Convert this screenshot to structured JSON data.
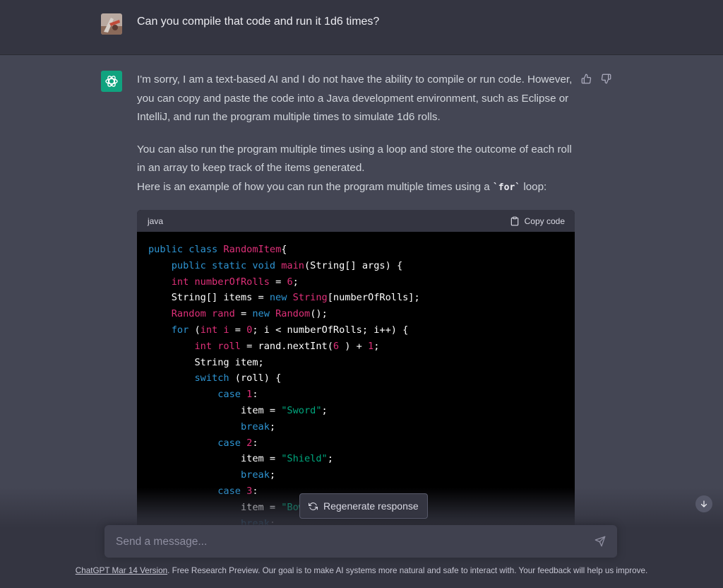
{
  "user_message": "Can you compile that code and run it 1d6 times?",
  "assistant": {
    "para1": "I'm sorry, I am a text-based AI and I do not have the ability to compile or run code. However, you can copy and paste the code into a Java development environment, such as Eclipse or IntelliJ, and run the program multiple times to simulate 1d6 rolls.",
    "para2_line1": "You can also run the program multiple times using a loop and store the outcome of each roll in an array to keep track of the items generated.",
    "para2_line2_prefix": "Here is an example of how you can run the program multiple times using a ",
    "para2_inline_code": "`for`",
    "para2_line2_suffix": " loop:"
  },
  "code_block": {
    "language": "java",
    "copy_label": "Copy code",
    "lines": [
      [
        [
          "kw",
          "public class "
        ],
        [
          "ty",
          "RandomItem"
        ],
        [
          "",
          "{"
        ]
      ],
      [
        [
          "",
          "    "
        ],
        [
          "kw",
          "public static void "
        ],
        [
          "ty",
          "main"
        ],
        [
          "",
          "(String[] args) {"
        ]
      ],
      [
        [
          "",
          "    "
        ],
        [
          "ty",
          "int numberOfRolls"
        ],
        [
          "",
          " = "
        ],
        [
          "num",
          "6"
        ],
        [
          "",
          ";"
        ]
      ],
      [
        [
          "",
          "    String[] items = "
        ],
        [
          "kw",
          "new "
        ],
        [
          "ty",
          "String"
        ],
        [
          "",
          "[numberOfRolls];"
        ]
      ],
      [
        [
          "",
          "    "
        ],
        [
          "ty",
          "Random rand"
        ],
        [
          "",
          " = "
        ],
        [
          "kw",
          "new "
        ],
        [
          "ty",
          "Random"
        ],
        [
          "",
          "();"
        ]
      ],
      [
        [
          "",
          "    "
        ],
        [
          "kw",
          "for "
        ],
        [
          "",
          "("
        ],
        [
          "ty",
          "int i"
        ],
        [
          "",
          " = "
        ],
        [
          "num",
          "0"
        ],
        [
          "",
          "; i < numberOfRolls; i++) {"
        ]
      ],
      [
        [
          "",
          "        "
        ],
        [
          "ty",
          "int roll"
        ],
        [
          "",
          " = rand.nextInt("
        ],
        [
          "num",
          "6"
        ],
        [
          "",
          " ) + "
        ],
        [
          "num",
          "1"
        ],
        [
          "",
          ";"
        ]
      ],
      [
        [
          "",
          "        String item;"
        ]
      ],
      [
        [
          "",
          "        "
        ],
        [
          "kw",
          "switch "
        ],
        [
          "",
          "(roll) {"
        ]
      ],
      [
        [
          "",
          "            "
        ],
        [
          "kw",
          "case "
        ],
        [
          "num",
          "1"
        ],
        [
          "",
          ":"
        ]
      ],
      [
        [
          "",
          "                item = "
        ],
        [
          "str",
          "\"Sword\""
        ],
        [
          "",
          ";"
        ]
      ],
      [
        [
          "",
          "                "
        ],
        [
          "kw",
          "break"
        ],
        [
          "",
          ";"
        ]
      ],
      [
        [
          "",
          "            "
        ],
        [
          "kw",
          "case "
        ],
        [
          "num",
          "2"
        ],
        [
          "",
          ":"
        ]
      ],
      [
        [
          "",
          "                item = "
        ],
        [
          "str",
          "\"Shield\""
        ],
        [
          "",
          ";"
        ]
      ],
      [
        [
          "",
          "                "
        ],
        [
          "kw",
          "break"
        ],
        [
          "",
          ";"
        ]
      ],
      [
        [
          "",
          "            "
        ],
        [
          "kw",
          "case "
        ],
        [
          "num",
          "3"
        ],
        [
          "",
          ":"
        ]
      ],
      [
        [
          "",
          "                item = "
        ],
        [
          "str",
          "\"Bow"
        ]
      ],
      [
        [
          "",
          "                "
        ],
        [
          "kw",
          "break"
        ],
        [
          "",
          ";"
        ]
      ]
    ]
  },
  "regenerate_label": "Regenerate response",
  "input": {
    "placeholder": "Send a message..."
  },
  "footer": {
    "link_text": "ChatGPT Mar 14 Version",
    "text": ". Free Research Preview. Our goal is to make AI systems more natural and safe to interact with. Your feedback will help us improve."
  },
  "colors": {
    "gpt_green": "#10a37f",
    "background": "#444654",
    "user_row": "#343541"
  }
}
